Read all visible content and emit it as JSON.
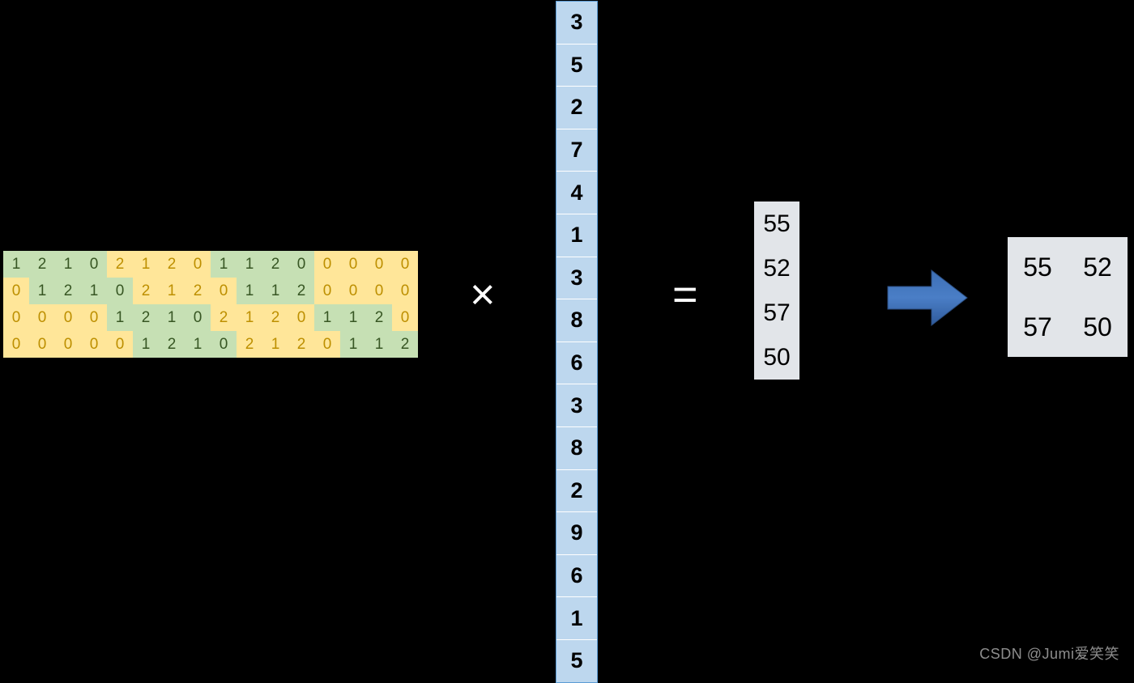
{
  "matrix": {
    "rows": 4,
    "cols": 16,
    "cells": [
      [
        {
          "v": "1",
          "c": "g"
        },
        {
          "v": "2",
          "c": "g"
        },
        {
          "v": "1",
          "c": "g"
        },
        {
          "v": "0",
          "c": "g"
        },
        {
          "v": "2",
          "c": "y"
        },
        {
          "v": "1",
          "c": "y"
        },
        {
          "v": "2",
          "c": "y"
        },
        {
          "v": "0",
          "c": "y"
        },
        {
          "v": "1",
          "c": "g"
        },
        {
          "v": "1",
          "c": "g"
        },
        {
          "v": "2",
          "c": "g"
        },
        {
          "v": "0",
          "c": "g"
        },
        {
          "v": "0",
          "c": "y"
        },
        {
          "v": "0",
          "c": "y"
        },
        {
          "v": "0",
          "c": "y"
        },
        {
          "v": "0",
          "c": "y"
        }
      ],
      [
        {
          "v": "0",
          "c": "y"
        },
        {
          "v": "1",
          "c": "g"
        },
        {
          "v": "2",
          "c": "g"
        },
        {
          "v": "1",
          "c": "g"
        },
        {
          "v": "0",
          "c": "g"
        },
        {
          "v": "2",
          "c": "y"
        },
        {
          "v": "1",
          "c": "y"
        },
        {
          "v": "2",
          "c": "y"
        },
        {
          "v": "0",
          "c": "y"
        },
        {
          "v": "1",
          "c": "g"
        },
        {
          "v": "1",
          "c": "g"
        },
        {
          "v": "2",
          "c": "g"
        },
        {
          "v": "0",
          "c": "y"
        },
        {
          "v": "0",
          "c": "y"
        },
        {
          "v": "0",
          "c": "y"
        },
        {
          "v": "0",
          "c": "y"
        }
      ],
      [
        {
          "v": "0",
          "c": "y"
        },
        {
          "v": "0",
          "c": "y"
        },
        {
          "v": "0",
          "c": "y"
        },
        {
          "v": "0",
          "c": "y"
        },
        {
          "v": "1",
          "c": "g"
        },
        {
          "v": "2",
          "c": "g"
        },
        {
          "v": "1",
          "c": "g"
        },
        {
          "v": "0",
          "c": "g"
        },
        {
          "v": "2",
          "c": "y"
        },
        {
          "v": "1",
          "c": "y"
        },
        {
          "v": "2",
          "c": "y"
        },
        {
          "v": "0",
          "c": "y"
        },
        {
          "v": "1",
          "c": "g"
        },
        {
          "v": "1",
          "c": "g"
        },
        {
          "v": "2",
          "c": "g"
        },
        {
          "v": "0",
          "c": "y"
        }
      ],
      [
        {
          "v": "0",
          "c": "y"
        },
        {
          "v": "0",
          "c": "y"
        },
        {
          "v": "0",
          "c": "y"
        },
        {
          "v": "0",
          "c": "y"
        },
        {
          "v": "0",
          "c": "y"
        },
        {
          "v": "1",
          "c": "g"
        },
        {
          "v": "2",
          "c": "g"
        },
        {
          "v": "1",
          "c": "g"
        },
        {
          "v": "0",
          "c": "g"
        },
        {
          "v": "2",
          "c": "y"
        },
        {
          "v": "1",
          "c": "y"
        },
        {
          "v": "2",
          "c": "y"
        },
        {
          "v": "0",
          "c": "y"
        },
        {
          "v": "1",
          "c": "g"
        },
        {
          "v": "1",
          "c": "g"
        },
        {
          "v": "2",
          "c": "g"
        }
      ]
    ]
  },
  "column_vector": [
    "3",
    "5",
    "2",
    "7",
    "4",
    "1",
    "3",
    "8",
    "6",
    "3",
    "8",
    "2",
    "9",
    "6",
    "1",
    "5"
  ],
  "result_vector": [
    "55",
    "52",
    "57",
    "50"
  ],
  "output_matrix": [
    [
      "55",
      "52"
    ],
    [
      "57",
      "50"
    ]
  ],
  "symbols": {
    "times": "×",
    "equals": "="
  },
  "watermark": "CSDN @Jumi爱笑笑"
}
